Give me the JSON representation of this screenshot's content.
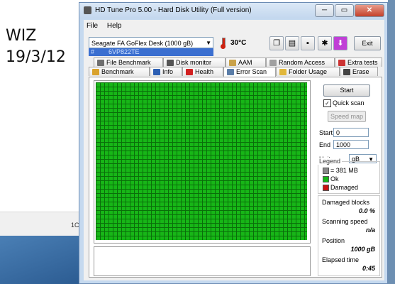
{
  "background": {
    "note_line1": "WIZ",
    "note_line2": "19/3/12",
    "strip_label": "1C",
    "topright_buttons": [
      "_",
      "▭",
      "✕"
    ]
  },
  "window": {
    "title": "HD Tune Pro 5.00 - Hard Disk Utility (Full version)",
    "buttons": {
      "minimize": "─",
      "maximize": "▭",
      "close": "✕"
    }
  },
  "menu": [
    "File",
    "Help"
  ],
  "toolbar": {
    "drive": "Seagate FA GoFlex Desk   (1000 gB)",
    "hash": "#",
    "serial": "6VP822TE",
    "temperature": "30°C",
    "exit_label": "Exit"
  },
  "tabs_top": [
    {
      "label": "File Benchmark",
      "icon_color": "#6f6f6f"
    },
    {
      "label": "Disk monitor",
      "icon_color": "#555555"
    },
    {
      "label": "AAM",
      "icon_color": "#c9a24a"
    },
    {
      "label": "Random Access",
      "icon_color": "#a0a0a0"
    },
    {
      "label": "Extra tests",
      "icon_color": "#cc3333"
    }
  ],
  "tabs_bottom": [
    {
      "label": "Benchmark",
      "icon_color": "#d9a22c"
    },
    {
      "label": "Info",
      "icon_color": "#2c5fb3"
    },
    {
      "label": "Health",
      "icon_color": "#d22020"
    },
    {
      "label": "Error Scan",
      "icon_color": "#5a7da8"
    },
    {
      "label": "Folder Usage",
      "icon_color": "#e1b73a"
    },
    {
      "label": "Erase",
      "icon_color": "#444444"
    }
  ],
  "active_tab": "Error Scan",
  "error_scan": {
    "start_label": "Start",
    "quick_scan_label": "Quick scan",
    "quick_scan_checked": true,
    "speed_map_label": "Speed map",
    "start_field_label": "Start",
    "start_value": "0",
    "end_field_label": "End",
    "end_value": "1000",
    "unit_label": "Unit",
    "unit_value": "gB"
  },
  "legend": {
    "title": "Legend",
    "items": [
      {
        "label": "= 381 MB",
        "color": "#888888"
      },
      {
        "label": "Ok",
        "color": "#17b617"
      },
      {
        "label": "Damaged",
        "color": "#cc1111"
      }
    ]
  },
  "stats": {
    "damaged_label": "Damaged blocks",
    "damaged_value": "0.0 %",
    "speed_label": "Scanning speed",
    "speed_value": "n/a",
    "position_label": "Position",
    "position_value": "1000 gB",
    "elapsed_label": "Elapsed time",
    "elapsed_value": "0:45"
  },
  "colors": {
    "ok_block": "#17b617",
    "window_frame": "#c5d9ef",
    "serial_highlight": "#3b6fd0"
  }
}
